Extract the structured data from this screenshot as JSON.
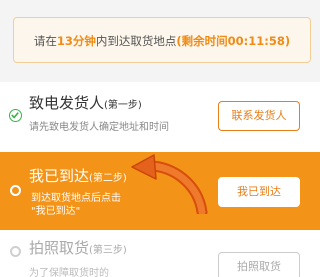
{
  "timer": {
    "prefix": "请在",
    "minutes": "13分钟",
    "middle": "内到达取货地点",
    "remaining": "(剩余时间00:11:58)"
  },
  "steps": [
    {
      "title": "致电发货人",
      "sub": "(第一步)",
      "desc": "请先致电发货人确定地址和时间",
      "button": "联系发货人",
      "status_icon": "check-circle-icon"
    },
    {
      "title": "我已到达",
      "sub": "(第二步)",
      "desc_line1": "到达取货地点后点击",
      "desc_line2": "\"我已到达\"",
      "button": "我已到达",
      "hint_icon": "curved-arrow-icon"
    },
    {
      "title": "拍照取货",
      "sub": "(第三步)",
      "desc": "为了保障取货时的",
      "button": "拍照取货"
    }
  ],
  "colors": {
    "accent": "#f39317",
    "success": "#3db04b",
    "timer_bg": "#fdf6ec"
  }
}
